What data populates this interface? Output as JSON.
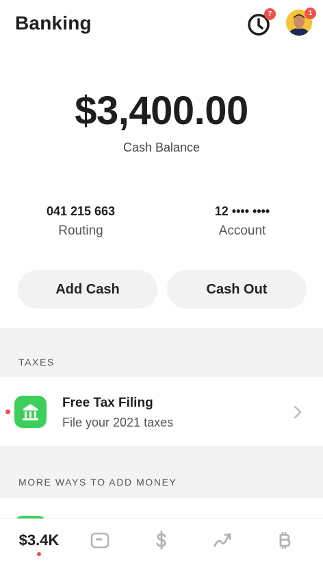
{
  "header": {
    "title": "Banking",
    "activity_badge": "7",
    "profile_badge": "1"
  },
  "balance": {
    "amount": "$3,400.00",
    "label": "Cash Balance"
  },
  "account_info": {
    "routing_value": "041 215 663",
    "routing_label": "Routing",
    "account_value": "12 •••• ••••",
    "account_label": "Account"
  },
  "actions": {
    "add_cash": "Add Cash",
    "cash_out": "Cash Out"
  },
  "taxes": {
    "section_label": "TAXES",
    "item_title": "Free Tax Filing",
    "item_subtitle": "File your 2021 taxes"
  },
  "more_ways": {
    "section_label": "MORE WAYS TO ADD MONEY"
  },
  "tabbar": {
    "money_label": "$3.4K",
    "icons": [
      "card-icon",
      "dollar-icon",
      "investing-icon",
      "bitcoin-icon"
    ]
  },
  "colors": {
    "accent_green": "#3ccf5a",
    "badge_red": "#f0514a",
    "section_gray": "#f3f3f3",
    "pill_gray": "#f2f2f2"
  }
}
